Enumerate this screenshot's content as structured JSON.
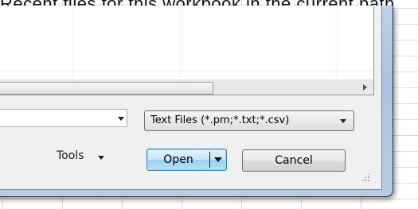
{
  "background": {
    "title_fragment": "Recent files for this workbook in the current path"
  },
  "file_dialog": {
    "filename_value": "",
    "filetype_selected": "Text Files (*.pm;*.txt;*.csv)",
    "tools_label": "Tools",
    "open_label": "Open",
    "cancel_label": "Cancel",
    "icons": {
      "filename_dropdown": "chevron-down-icon",
      "filetype_dropdown": "chevron-down-icon",
      "tools_dropdown": "chevron-down-icon",
      "open_split": "chevron-down-icon",
      "scroll_right": "chevron-right-icon",
      "resize": "resize-grip-icon"
    },
    "colors": {
      "accent_border": "#3c7fb1",
      "frame": "#a9c3e0"
    }
  }
}
